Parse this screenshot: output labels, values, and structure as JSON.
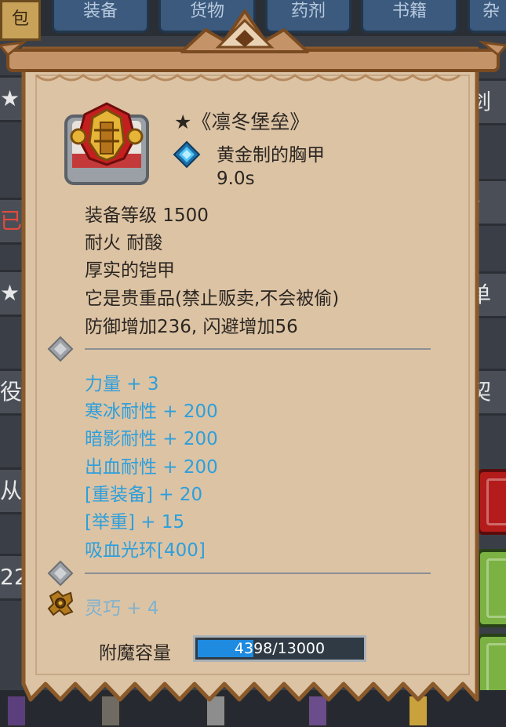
{
  "background": {
    "corner_tab": "包",
    "tabs": [
      "装备",
      "货物",
      "药剂",
      "书籍",
      "杂"
    ],
    "left_rows": [
      {
        "text": "★"
      },
      {
        "text": "已"
      },
      {
        "text": "★"
      },
      {
        "text": "役"
      },
      {
        "text": "从"
      },
      {
        "text": "22"
      }
    ],
    "right_rows": [
      {
        "text": "剑"
      },
      {
        "text": "》"
      },
      {
        "text": "单"
      },
      {
        "text": "契"
      }
    ]
  },
  "item": {
    "name": "★《凛冬堡垒》",
    "type": "黄金制的胸甲",
    "time": "9.0s",
    "equip_level": "装备等级 1500",
    "resist": "耐火  耐酸",
    "trait": "厚实的铠甲",
    "valuable_note": "它是贵重品(禁止贩卖,不会被偷)",
    "defense_line": "防御增加236, 闪避增加56",
    "stats": [
      "力量 + 3",
      "寒冰耐性 + 200",
      "暗影耐性 + 200",
      "出血耐性 + 200",
      "[重装备] + 20",
      "[举重] + 15",
      "吸血光环[400]"
    ],
    "enchant_stat": "灵巧 + 4",
    "capacity_label": "附魔容量",
    "capacity_text": "4398/13000",
    "capacity_current": 4398,
    "capacity_max": 13000
  },
  "colors": {
    "panel": "#dcc3a4",
    "panel_border": "#8b5a2b",
    "stat_blue": "#2d9fdc",
    "text_dark": "#2b2621",
    "bar_fill": "#1f8be0"
  },
  "icons": {
    "item": "chest-armor-icon",
    "description": "blue-diamond-icon",
    "section": "gray-diamond-icon",
    "enchant": "gear-rune-icon"
  }
}
